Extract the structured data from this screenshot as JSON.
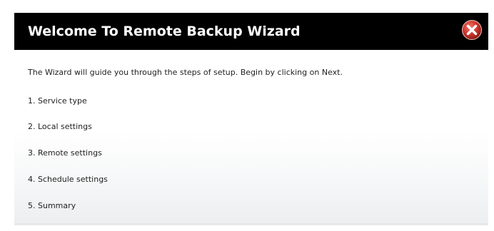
{
  "dialog": {
    "title": "Welcome To Remote Backup Wizard",
    "close_icon": "close-icon",
    "intro": "The Wizard will guide you through the steps of setup. Begin by clicking on Next.",
    "steps": [
      "1. Service type",
      "2. Local settings",
      "3. Remote settings",
      "4. Schedule settings",
      "5. Summary"
    ]
  },
  "colors": {
    "title_bar": "#000000",
    "title_text": "#ffffff",
    "close_button": "#c9302c"
  }
}
